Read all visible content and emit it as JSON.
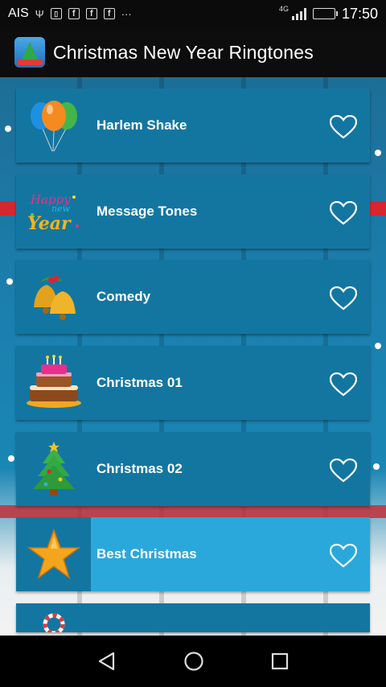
{
  "status_bar": {
    "carrier": "AIS",
    "network_type": "4G",
    "time": "17:50",
    "overflow_glyph": "···",
    "notification_icons": [
      "usb-icon",
      "sim-icon",
      "facebook-icon",
      "facebook-icon",
      "facebook-icon"
    ]
  },
  "app_bar": {
    "title": "Christmas New Year Ringtones",
    "icon": "app-tree-icon"
  },
  "ringtones": [
    {
      "label": "Harlem Shake",
      "thumb": "balloons-icon",
      "selected": false
    },
    {
      "label": "Message Tones",
      "thumb": "happy-new-year-icon",
      "selected": false
    },
    {
      "label": "Comedy",
      "thumb": "bells-icon",
      "selected": false
    },
    {
      "label": "Christmas 01",
      "thumb": "cake-icon",
      "selected": false
    },
    {
      "label": "Christmas 02",
      "thumb": "christmas-tree-icon",
      "selected": false
    },
    {
      "label": "Best Christmas",
      "thumb": "star-icon",
      "selected": true
    },
    {
      "label": "",
      "thumb": "candy-cane-icon",
      "selected": false
    }
  ],
  "nav_bar": {
    "back": "back-icon",
    "home": "home-icon",
    "recents": "recents-icon"
  },
  "colors": {
    "item_bg": "#1376a1",
    "item_selected_bg": "#2aa8dc",
    "bar_bg": "#0d0d0d"
  }
}
